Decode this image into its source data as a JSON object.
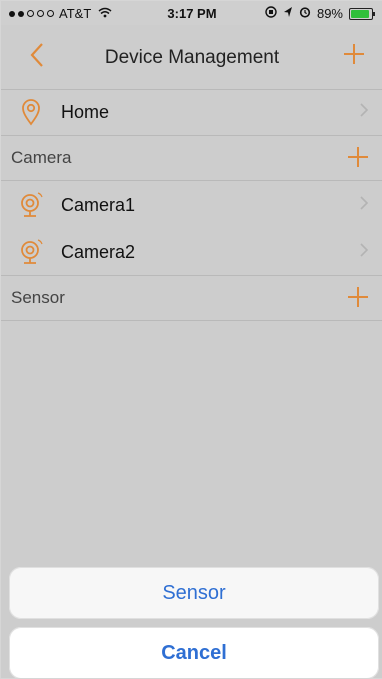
{
  "status_bar": {
    "carrier": "AT&T",
    "time": "3:17 PM",
    "battery": "89%",
    "battery_level": 0.89
  },
  "nav": {
    "title": "Device Management"
  },
  "home_row": {
    "label": "Home",
    "icon": "location-pin-icon"
  },
  "sections": {
    "camera": {
      "title": "Camera",
      "items": [
        {
          "label": "Camera1",
          "icon": "camera-icon"
        },
        {
          "label": "Camera2",
          "icon": "camera-icon"
        }
      ]
    },
    "sensor": {
      "title": "Sensor"
    }
  },
  "action_sheet": {
    "sensor_label": "Sensor",
    "cancel_label": "Cancel"
  },
  "colors": {
    "accent": "#e08a3a",
    "sheet_text": "#2f6fd3"
  }
}
